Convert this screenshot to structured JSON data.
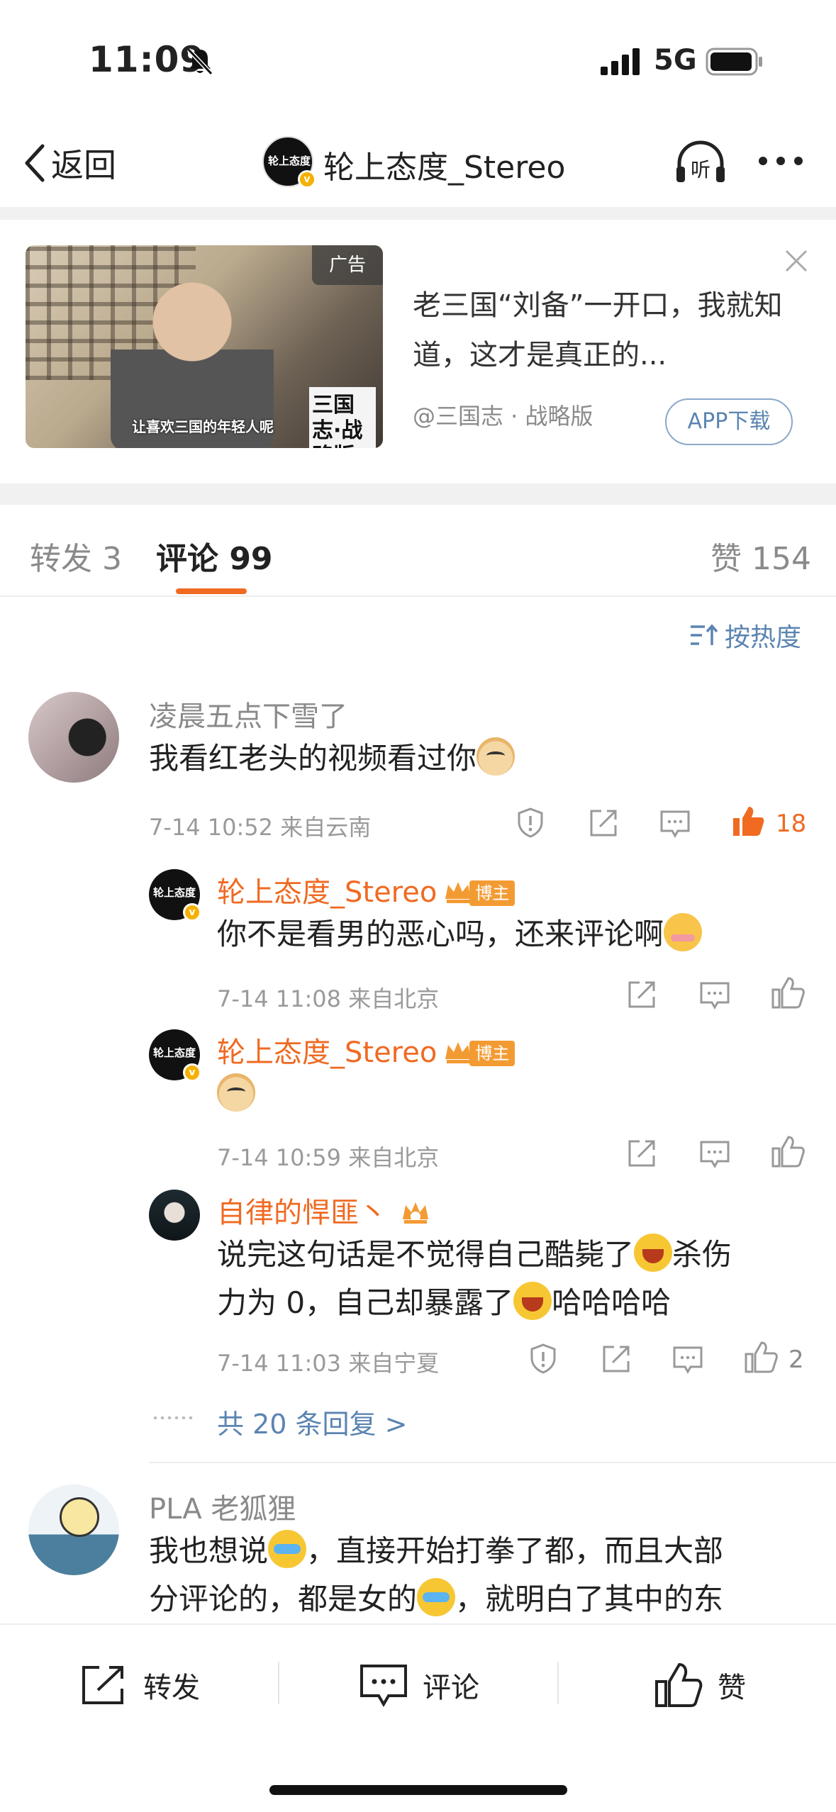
{
  "status_bar": {
    "time": "11:09",
    "network": "5G"
  },
  "nav": {
    "back_label": "返回",
    "title": "轮上态度_Stereo",
    "avatar_text": "轮上态度",
    "listen_icon": "headphones-icon",
    "more_icon": "more-icon"
  },
  "ad": {
    "badge": "广告",
    "caption": "让喜欢三国的年轻人呢",
    "corner_text": "三国志·战略版",
    "text": "老三国“刘备”一开口，我就知道，这才是真正的...",
    "source": "@三国志 · 战略版",
    "button": "APP下载"
  },
  "tabs": {
    "repost": "转发 3",
    "comments": "评论 99",
    "likes": "赞 154"
  },
  "sort": {
    "label": "按热度"
  },
  "comments": [
    {
      "user": "凌晨五点下雪了",
      "text": "我看红老头的视频看过你",
      "meta": "7-14 10:52 来自云南",
      "likes": "18"
    },
    {
      "user": "PLA 老狐狸",
      "text_part1": "我也想说",
      "text_part2": "，直接开始打拳了都，而且大部",
      "text_part3": "分评论的，都是女的",
      "text_part4": "，就明白了其中的东"
    }
  ],
  "replies": [
    {
      "user": "轮上态度_Stereo",
      "tag": "博主",
      "text": "你不是看男的恶心吗，还来评论啊",
      "meta": "7-14 11:08 来自北京"
    },
    {
      "user": "轮上态度_Stereo",
      "tag": "博主",
      "meta": "7-14 10:59 来自北京"
    },
    {
      "user": "自律的悍匪丶",
      "text_line1a": "说完这句话是不觉得自己酷毙了",
      "text_line1b": "杀伤",
      "text_line2a": "力为 0，自己却暴露了",
      "text_line2b": "哈哈哈哈",
      "meta": "7-14 11:03 来自宁夏",
      "likes": "2"
    }
  ],
  "more_replies": "共 20 条回复 >",
  "bottom_bar": {
    "repost": "转发",
    "comment": "评论",
    "like": "赞"
  },
  "colors": {
    "accent": "#f06a22",
    "link": "#5b84b1",
    "muted": "#8a8a8a"
  }
}
